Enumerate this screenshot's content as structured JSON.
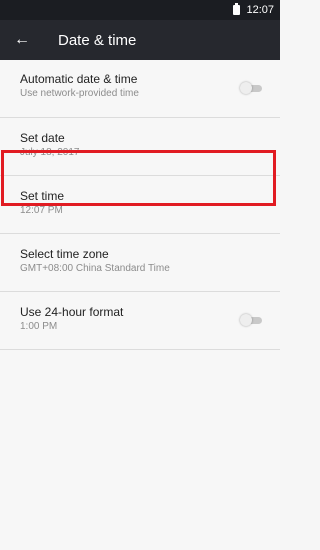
{
  "status_bar": {
    "time": "12:07"
  },
  "app_bar": {
    "back_icon": "arrow-left-icon",
    "title": "Date & time"
  },
  "settings": [
    {
      "title": "Automatic date & time",
      "subtitle": "Use network-provided time",
      "toggle": false
    },
    {
      "title": "Set date",
      "subtitle": "July 18, 2017"
    },
    {
      "title": "Set time",
      "subtitle": "12:07 PM",
      "highlighted": true
    },
    {
      "title": "Select time zone",
      "subtitle": "GMT+08:00 China Standard Time"
    },
    {
      "title": "Use 24-hour format",
      "subtitle": "1:00 PM",
      "toggle": false
    }
  ],
  "colors": {
    "status_bar": "#1b1d22",
    "app_bar": "#26282e",
    "highlight_border": "#e11b22"
  }
}
